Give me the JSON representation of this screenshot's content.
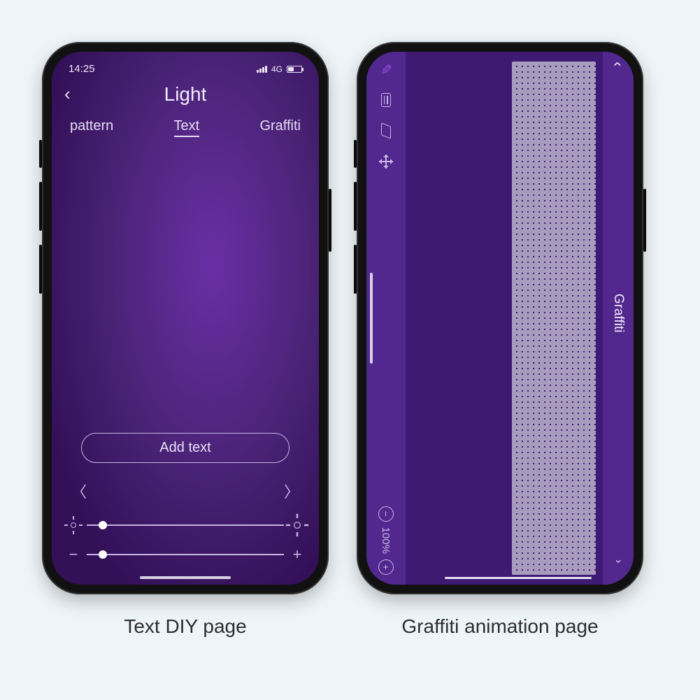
{
  "captions": {
    "left": "Text DIY page",
    "right": "Graffiti animation page"
  },
  "textScreen": {
    "status": {
      "time": "14:25",
      "network": "4G"
    },
    "title": "Light",
    "tabs": {
      "pattern": "pattern",
      "text": "Text",
      "graffiti": "Graffiti"
    },
    "addText": "Add text",
    "sliders": {
      "brightnessPercent": 8,
      "speedPercent": 8
    }
  },
  "graffitiScreen": {
    "title": "Graffiti",
    "zoom": "100%",
    "tools": {
      "pen": "pen-icon",
      "palette": "palette-icon",
      "eraser": "eraser-icon",
      "move": "move-icon",
      "zoomOut": "minus",
      "zoomIn": "plus"
    }
  }
}
